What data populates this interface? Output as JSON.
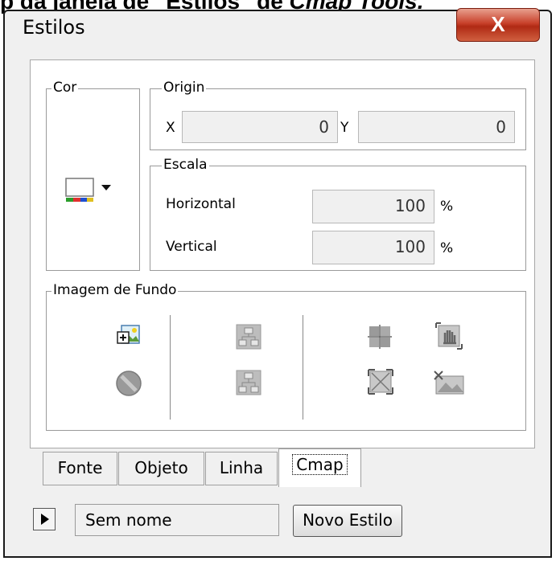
{
  "caption": {
    "prefix": "p da janela de \"Estilos\" de ",
    "app_name": "Cmap Tools."
  },
  "window": {
    "title": "Estilos",
    "close_glyph": "X",
    "accent_close": "#c8402a"
  },
  "cor": {
    "legend": "Cor",
    "icon": "color-picker-icon"
  },
  "origin": {
    "legend": "Origin",
    "x_label": "X",
    "x_value": "0",
    "y_label": "Y",
    "y_value": "0"
  },
  "escala": {
    "legend": "Escala",
    "horizontal_label": "Horizontal",
    "horizontal_value": "100",
    "horizontal_unit": "%",
    "vertical_label": "Vertical",
    "vertical_value": "100",
    "vertical_unit": "%"
  },
  "imagem_fundo": {
    "legend": "Imagem de Fundo",
    "icons": [
      "add-image-icon",
      "remove-image-icon",
      "layout-top-icon",
      "layout-bottom-icon",
      "tile-icon",
      "hand-move-icon",
      "fit-icon",
      "crop-icon"
    ]
  },
  "tabs": [
    {
      "label": "Fonte",
      "active": false
    },
    {
      "label": "Objeto",
      "active": false
    },
    {
      "label": "Linha",
      "active": false
    },
    {
      "label": "Cmap",
      "active": true
    }
  ],
  "footer": {
    "style_name": "Sem nome",
    "new_style_label": "Novo Estilo"
  }
}
